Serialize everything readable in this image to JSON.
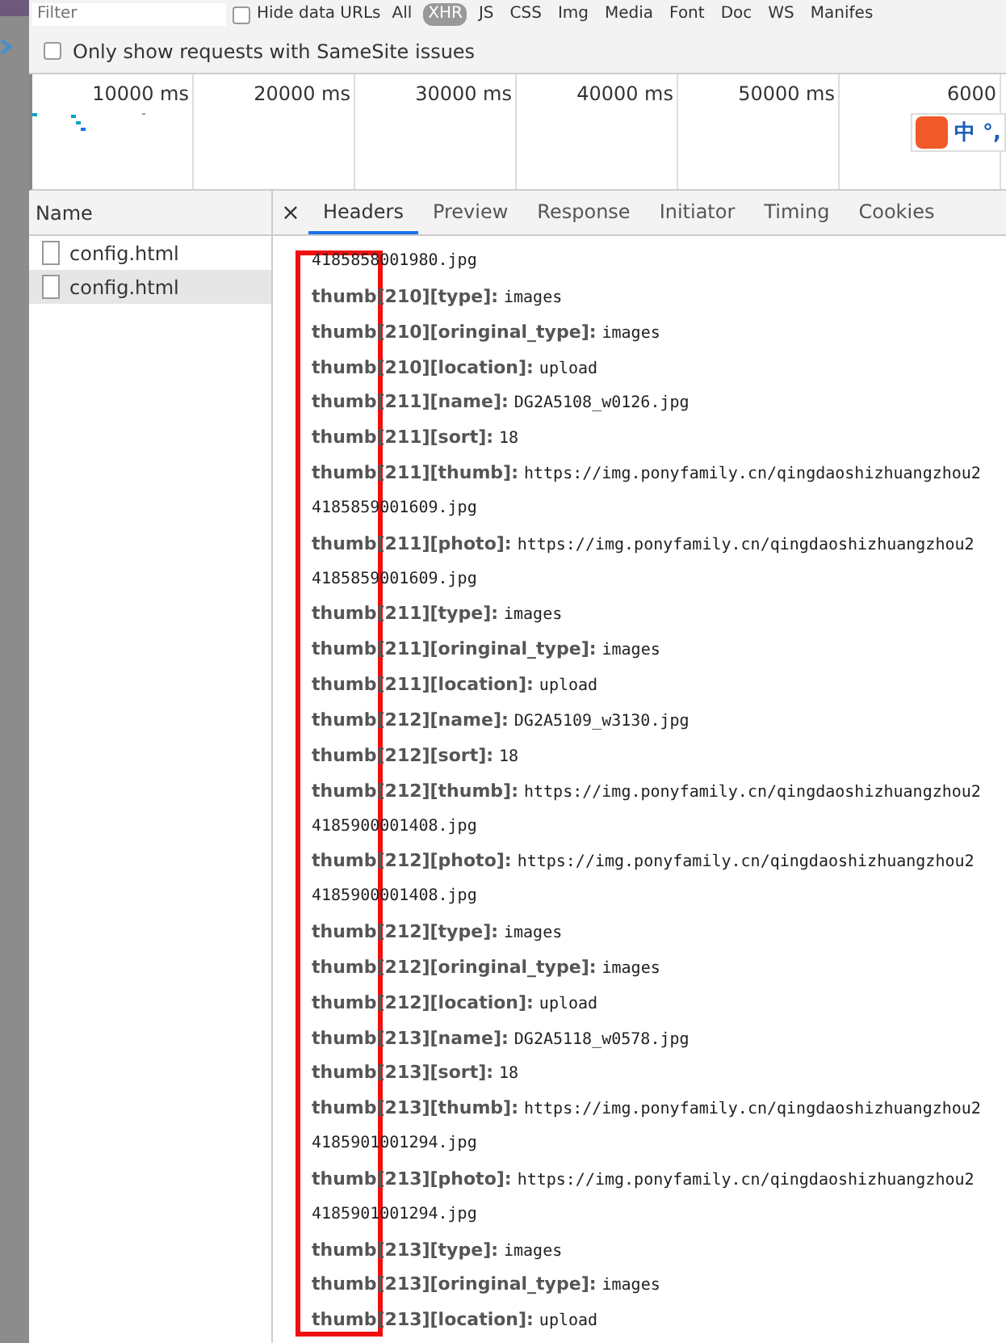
{
  "toolbar": {
    "filter": {
      "placeholder": "Filter"
    },
    "hide_data_urls": {
      "label": "Hide data URLs",
      "checked": false
    },
    "types": [
      {
        "label": "All",
        "selected": false
      },
      {
        "label": "XHR",
        "selected": true
      },
      {
        "label": "JS",
        "selected": false
      },
      {
        "label": "CSS",
        "selected": false
      },
      {
        "label": "Img",
        "selected": false
      },
      {
        "label": "Media",
        "selected": false
      },
      {
        "label": "Font",
        "selected": false
      },
      {
        "label": "Doc",
        "selected": false
      },
      {
        "label": "WS",
        "selected": false
      },
      {
        "label": "Manifes",
        "selected": false
      }
    ]
  },
  "samesite_filter": {
    "label": "Only show requests with SameSite issues",
    "checked": false
  },
  "timeline": {
    "ticks": [
      "10000 ms",
      "20000 ms",
      "30000 ms",
      "40000 ms",
      "50000 ms",
      "6000"
    ]
  },
  "ime_widget": {
    "label": "中 °,"
  },
  "requests": {
    "column": "Name",
    "items": [
      {
        "name": "config.html",
        "selected": false
      },
      {
        "name": "config.html",
        "selected": true
      }
    ]
  },
  "detail": {
    "close": "×",
    "tabs": [
      {
        "label": "Headers",
        "selected": true
      },
      {
        "label": "Preview",
        "selected": false
      },
      {
        "label": "Response",
        "selected": false
      },
      {
        "label": "Initiator",
        "selected": false
      },
      {
        "label": "Timing",
        "selected": false
      },
      {
        "label": "Cookies",
        "selected": false
      }
    ],
    "lines": [
      {
        "kind": "continuation",
        "text": "4185858001980.jpg"
      },
      {
        "kind": "field",
        "key": "thumb[210][type]:",
        "value": "images"
      },
      {
        "kind": "field",
        "key": "thumb[210][oringinal_type]:",
        "value": "images"
      },
      {
        "kind": "field",
        "key": "thumb[210][location]:",
        "value": "upload"
      },
      {
        "kind": "field",
        "key": "thumb[211][name]:",
        "value": "DG2A5108_w0126.jpg"
      },
      {
        "kind": "field",
        "key": "thumb[211][sort]:",
        "value": "18"
      },
      {
        "kind": "field",
        "key": "thumb[211][thumb]:",
        "value": "https://img.ponyfamily.cn/qingdaoshizhuangzhou2"
      },
      {
        "kind": "continuation",
        "text": "4185859001609.jpg"
      },
      {
        "kind": "field",
        "key": "thumb[211][photo]:",
        "value": "https://img.ponyfamily.cn/qingdaoshizhuangzhou2"
      },
      {
        "kind": "continuation",
        "text": "4185859001609.jpg"
      },
      {
        "kind": "field",
        "key": "thumb[211][type]:",
        "value": "images"
      },
      {
        "kind": "field",
        "key": "thumb[211][oringinal_type]:",
        "value": "images"
      },
      {
        "kind": "field",
        "key": "thumb[211][location]:",
        "value": "upload"
      },
      {
        "kind": "field",
        "key": "thumb[212][name]:",
        "value": "DG2A5109_w3130.jpg"
      },
      {
        "kind": "field",
        "key": "thumb[212][sort]:",
        "value": "18"
      },
      {
        "kind": "field",
        "key": "thumb[212][thumb]:",
        "value": "https://img.ponyfamily.cn/qingdaoshizhuangzhou2"
      },
      {
        "kind": "continuation",
        "text": "4185900001408.jpg"
      },
      {
        "kind": "field",
        "key": "thumb[212][photo]:",
        "value": "https://img.ponyfamily.cn/qingdaoshizhuangzhou2"
      },
      {
        "kind": "continuation",
        "text": "4185900001408.jpg"
      },
      {
        "kind": "field",
        "key": "thumb[212][type]:",
        "value": "images"
      },
      {
        "kind": "field",
        "key": "thumb[212][oringinal_type]:",
        "value": "images"
      },
      {
        "kind": "field",
        "key": "thumb[212][location]:",
        "value": "upload"
      },
      {
        "kind": "field",
        "key": "thumb[213][name]:",
        "value": "DG2A5118_w0578.jpg"
      },
      {
        "kind": "field",
        "key": "thumb[213][sort]:",
        "value": "18"
      },
      {
        "kind": "field",
        "key": "thumb[213][thumb]:",
        "value": "https://img.ponyfamily.cn/qingdaoshizhuangzhou2"
      },
      {
        "kind": "continuation",
        "text": "4185901001294.jpg"
      },
      {
        "kind": "field",
        "key": "thumb[213][photo]:",
        "value": "https://img.ponyfamily.cn/qingdaoshizhuangzhou2"
      },
      {
        "kind": "continuation",
        "text": "4185901001294.jpg"
      },
      {
        "kind": "field",
        "key": "thumb[213][type]:",
        "value": "images"
      },
      {
        "kind": "field",
        "key": "thumb[213][oringinal_type]:",
        "value": "images"
      },
      {
        "kind": "field",
        "key": "thumb[213][location]:",
        "value": "upload"
      }
    ]
  }
}
